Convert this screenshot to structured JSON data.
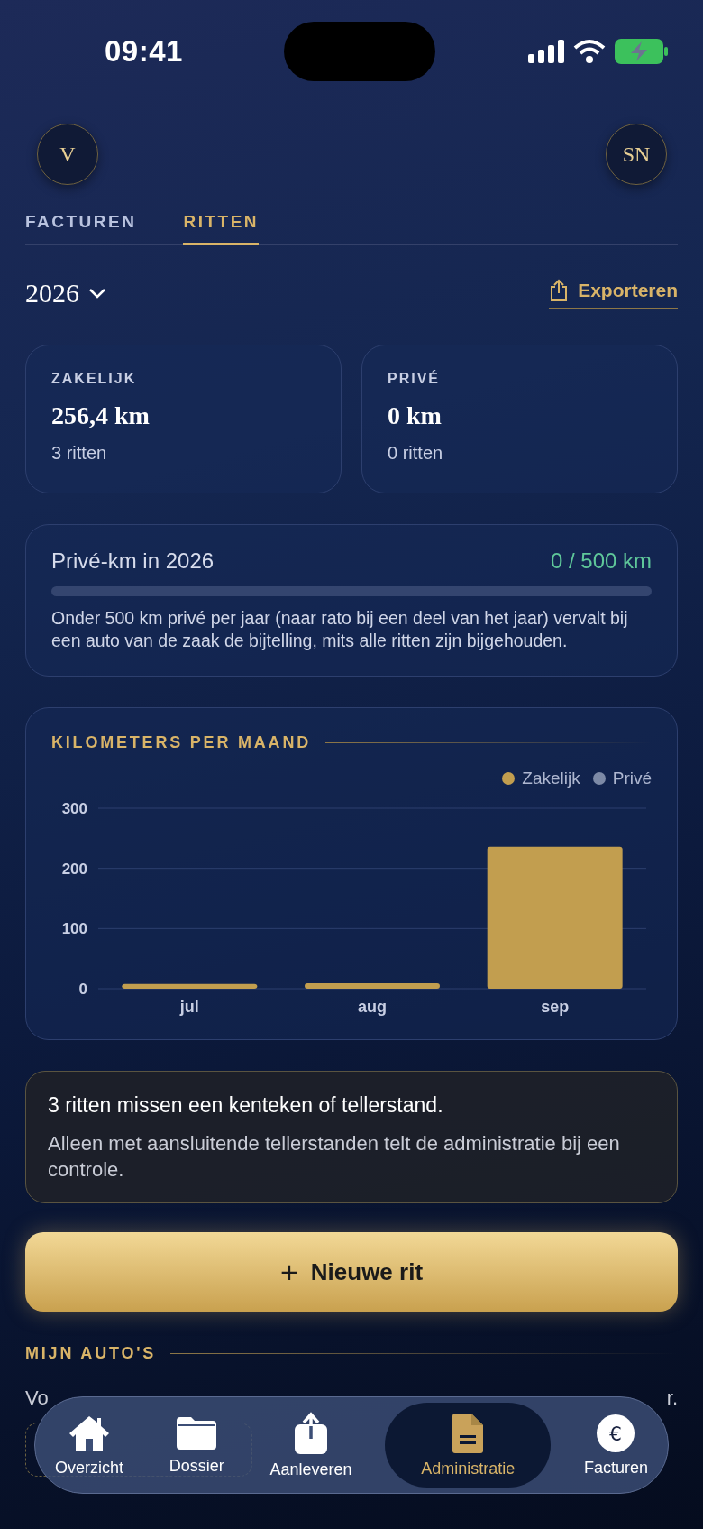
{
  "status_bar": {
    "time": "09:41"
  },
  "header": {
    "logo": "V",
    "avatar": "SN"
  },
  "tabs": [
    {
      "label": "FACTUREN",
      "selected": false
    },
    {
      "label": "RITTEN",
      "selected": true
    }
  ],
  "year": "2026",
  "export": "Exporteren",
  "stats": [
    {
      "label": "ZAKELIJK",
      "value": "256,4 km",
      "sub": "3 ritten"
    },
    {
      "label": "PRIVÉ",
      "value": "0 km",
      "sub": "0 ritten"
    }
  ],
  "private_limit": {
    "title": "Privé-km in 2026",
    "reading": "0 / 500 km",
    "level": 0,
    "note": "Onder 500 km privé per jaar (naar rato bij een deel van het jaar) vervalt bij een auto van de zaak de bijtelling, mits alle ritten zijn bijgehouden."
  },
  "chart_card": {
    "title": "KILOMETERS PER MAAND",
    "chart_data": {
      "type": "bar",
      "stacked": true,
      "categories": [
        "jul",
        "aug",
        "sep"
      ],
      "series": [
        {
          "name": "Zakelijk",
          "color": "#c29e4f",
          "values": [
            8,
            9,
            236
          ]
        },
        {
          "name": "Privé",
          "color": "#7d8aa6",
          "values": [
            0,
            0,
            0
          ]
        }
      ],
      "ylim": [
        0,
        300
      ],
      "yticks": [
        0,
        100,
        200,
        300
      ]
    }
  },
  "warning": {
    "title": "3 ritten missen een kenteken of tellerstand.",
    "text": "Alleen met aansluitende tellerstanden telt de administratie bij een controle."
  },
  "new_trip_button": {
    "icon": "+",
    "label": "Nieuwe rit"
  },
  "my_cars": {
    "title": "MIJN AUTO'S",
    "intro_start": "Vo",
    "intro_end": "r."
  },
  "bottom_nav": [
    {
      "label": "Overzicht",
      "kind": "home",
      "selected": false
    },
    {
      "label": "Dossier",
      "kind": "folder",
      "selected": false
    },
    {
      "label": "Aanleveren",
      "kind": "upload",
      "selected": false
    },
    {
      "label": "Administratie",
      "kind": "document",
      "selected": true
    },
    {
      "label": "Facturen",
      "kind": "currency",
      "symbol": "€",
      "selected": false
    }
  ]
}
